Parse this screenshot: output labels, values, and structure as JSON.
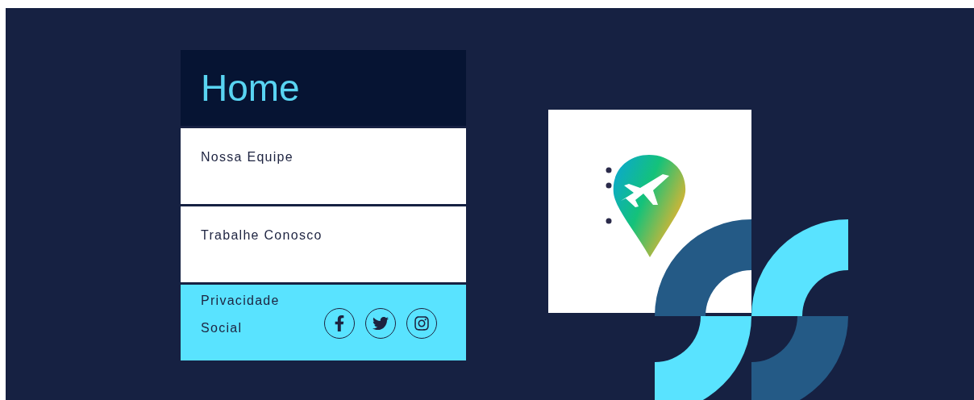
{
  "menu": {
    "title": "Home",
    "items": [
      {
        "label": "Nossa Equipe"
      },
      {
        "label": "Trabalhe Conosco"
      }
    ],
    "footer": {
      "privacy": "Privacidade",
      "social": "Social"
    }
  }
}
